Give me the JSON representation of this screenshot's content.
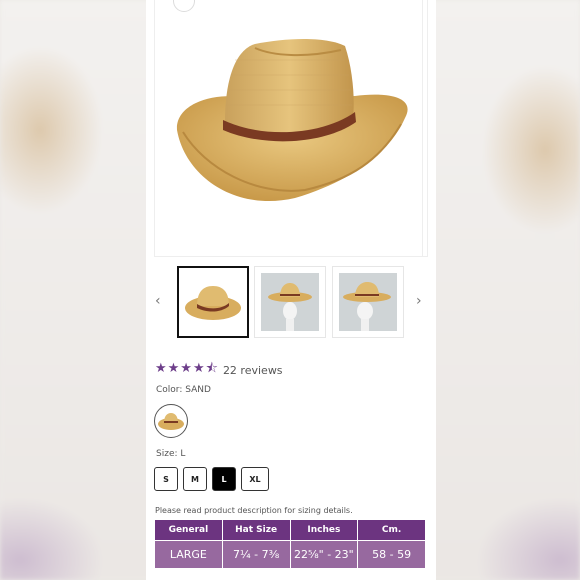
{
  "product": {
    "rating": {
      "stars": "★★★★⯪",
      "value": 4.5,
      "reviews_text": "22 reviews"
    },
    "color": {
      "label": "Color: SAND"
    },
    "size": {
      "label": "Size: L",
      "options": [
        "S",
        "M",
        "L",
        "XL"
      ],
      "selected": "L"
    },
    "note": "Please read product description for sizing details.",
    "sizing_table": {
      "headers": [
        "General",
        "Hat Size",
        "Inches",
        "Cm."
      ],
      "row": [
        "LARGE",
        "7¼ - 7⅜",
        "22⅝\" - 23\"",
        "58 - 59"
      ]
    }
  },
  "gallery": {
    "prev_icon": "‹",
    "next_icon": "›",
    "thumbnails": [
      "hat-front-view",
      "hat-on-mannequin-front",
      "hat-on-mannequin-side"
    ],
    "active_index": 0
  },
  "colors": {
    "accent_purple": "#6c3480",
    "table_row": "#97699f",
    "star": "#6d3e8a",
    "straw": "#d8ad5e",
    "band": "#7a3a22"
  }
}
